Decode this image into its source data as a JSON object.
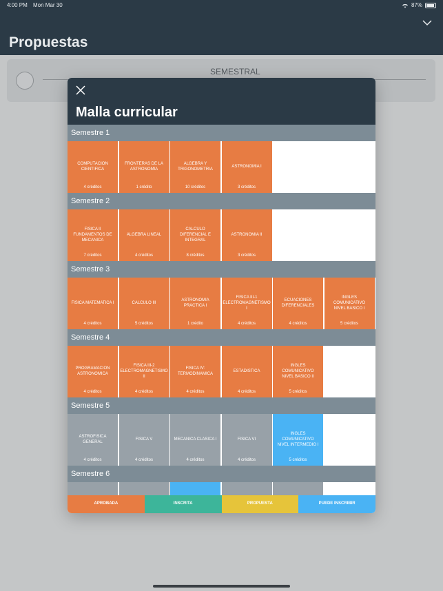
{
  "status_bar": {
    "time": "4:00 PM",
    "date": "Mon Mar 30",
    "battery": "87%"
  },
  "header": {
    "title": "Propuestas"
  },
  "background_card": {
    "segment_label": "SEMESTRAL"
  },
  "modal": {
    "title": "Malla curricular",
    "semesters": [
      {
        "label": "Semestre 1",
        "courses": [
          {
            "name": "COMPUTACION CIENTIFICA",
            "credits": "4 créditos",
            "status": "aprobada"
          },
          {
            "name": "FRONTERAS DE LA ASTRONOMIA",
            "credits": "1 crédito",
            "status": "aprobada"
          },
          {
            "name": "ALGEBRA Y TRIGONOMETRIA",
            "credits": "10 créditos",
            "status": "aprobada"
          },
          {
            "name": "ASTRONOMIA I",
            "credits": "3 créditos",
            "status": "aprobada"
          }
        ]
      },
      {
        "label": "Semestre 2",
        "courses": [
          {
            "name": "FISICA II FUNDAMENTOS DE MECANICA",
            "credits": "7 créditos",
            "status": "aprobada"
          },
          {
            "name": "ALGEBRA LINEAL",
            "credits": "4 créditos",
            "status": "aprobada"
          },
          {
            "name": "CALCULO DIFERENCIAL E INTEGRAL",
            "credits": "8 créditos",
            "status": "aprobada"
          },
          {
            "name": "ASTRONOMIA II",
            "credits": "3 créditos",
            "status": "aprobada"
          }
        ]
      },
      {
        "label": "Semestre 3",
        "courses": [
          {
            "name": "FISICA MATEMATICA I",
            "credits": "4 créditos",
            "status": "aprobada"
          },
          {
            "name": "CALCULO III",
            "credits": "5 créditos",
            "status": "aprobada"
          },
          {
            "name": "ASTRONOMIA PRACTICA I",
            "credits": "1 crédito",
            "status": "aprobada"
          },
          {
            "name": "FISICA III-1 ELECTROMAGNETISMO I",
            "credits": "4 créditos",
            "status": "aprobada"
          },
          {
            "name": "ECUACIONES DIFERENCIALES",
            "credits": "4 créditos",
            "status": "aprobada"
          },
          {
            "name": "INGLES COMUNICATIVO NIVEL BASICO I",
            "credits": "5 créditos",
            "status": "aprobada"
          }
        ]
      },
      {
        "label": "Semestre 4",
        "courses": [
          {
            "name": "PROGRAMACION ASTRONOMICA",
            "credits": "4 créditos",
            "status": "aprobada"
          },
          {
            "name": "FISICA III-2 ELECTROMAGNETISMO II",
            "credits": "4 créditos",
            "status": "aprobada"
          },
          {
            "name": "FISICA IV: TERMODINAMICA",
            "credits": "4 créditos",
            "status": "aprobada"
          },
          {
            "name": "ESTADISTICA",
            "credits": "4 créditos",
            "status": "aprobada"
          },
          {
            "name": "INGLES COMUNICATIVO NIVEL BASICO II",
            "credits": "5 créditos",
            "status": "aprobada"
          }
        ]
      },
      {
        "label": "Semestre 5",
        "courses": [
          {
            "name": "ASTROFISICA GENERAL",
            "credits": "4 créditos",
            "status": "pendiente"
          },
          {
            "name": "FISICA V",
            "credits": "4 créditos",
            "status": "pendiente"
          },
          {
            "name": "MECANICA CLASICA I",
            "credits": "4 créditos",
            "status": "pendiente"
          },
          {
            "name": "FISICA VI",
            "credits": "4 créditos",
            "status": "pendiente"
          },
          {
            "name": "INGLES COMUNICATIVO NIVEL INTERMEDIO I",
            "credits": "5 créditos",
            "status": "puede_inscribir"
          }
        ]
      },
      {
        "label": "Semestre 6",
        "courses": [
          {
            "name": "",
            "credits": "",
            "status": "pendiente"
          },
          {
            "name": "",
            "credits": "",
            "status": "pendiente"
          },
          {
            "name": "",
            "credits": "",
            "status": "puede_inscribir"
          },
          {
            "name": "",
            "credits": "",
            "status": "pendiente"
          },
          {
            "name": "",
            "credits": "",
            "status": "pendiente"
          }
        ]
      }
    ],
    "legend": [
      {
        "label": "APROBADA",
        "color": "#e77c43"
      },
      {
        "label": "INSCRITA",
        "color": "#3db59a"
      },
      {
        "label": "PROPUESTA",
        "color": "#e6c43a"
      },
      {
        "label": "PUEDE INSCRIBIR",
        "color": "#4ab3f4"
      }
    ]
  }
}
